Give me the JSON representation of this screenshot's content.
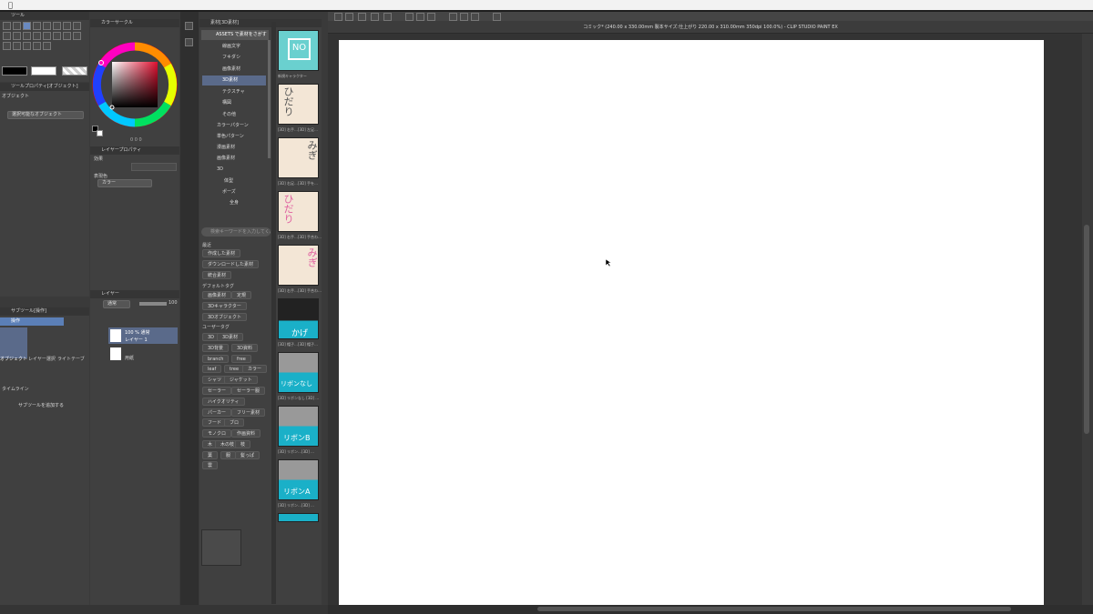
{
  "window_title": "コミック* (240.00 x 330.00mm 製本サイズ:仕上がり 220.00 x 310.00mm 350dpi 100.0%) - CLIP STUDIO PAINT EX",
  "tool_panel": {
    "title": "ツール"
  },
  "color_panel": {
    "title": "カラーサークル",
    "values": "0 0 0"
  },
  "tool_property": {
    "title": "ツールプロパティ[オブジェクト]",
    "subtitle": "オブジェクト",
    "dropdown": "選択可能なオブジェクト"
  },
  "layer_property": {
    "title": "レイヤープロパティ",
    "effect_label": "効果",
    "color_label": "表現色",
    "color_value": "カラー"
  },
  "layer_panel": {
    "title": "レイヤー",
    "blend_mode": "通常",
    "opacity": "100",
    "layers": [
      {
        "line1": "100 % 通常",
        "line2": "レイヤー 1"
      },
      {
        "line1": "",
        "line2": "用紙"
      }
    ]
  },
  "subtool_panel": {
    "title": "サブツール[操作]",
    "group_label": "操作",
    "tools": [
      "オブジェクト",
      "レイヤー選択",
      "ライトテーブ",
      "タイムライン"
    ],
    "add_label": "サブツールを追加する"
  },
  "material_panel": {
    "title": "素材[3D素材]",
    "tree": [
      "ASSETS で素材をさがす",
      "線画文字",
      "フキダシ",
      "画像素材",
      "3D素材",
      "テクスチャ",
      "構図",
      "その他",
      "カラーパターン",
      "単色パターン",
      "漫画素材",
      "画像素材",
      "3D",
      "体型",
      "ポーズ",
      "全身"
    ],
    "search_placeholder": "検索キーワードを入力してくだ...",
    "section_labels": {
      "history": "最近",
      "default": "デフォルトタグ",
      "user": "ユーザータグ"
    },
    "history_tags": [
      "作成した素材",
      "ダウンロードした素材",
      "統合素材"
    ],
    "default_tags": [
      "画像素材",
      "定規",
      "3Dキャラクター",
      "3Dオブジェクト"
    ],
    "user_tags": [
      "3D",
      "3D素材",
      "3D背景",
      "3D資料",
      "branch",
      "free",
      "leaf",
      "tree",
      "カラー",
      "シャツ",
      "ジャケット",
      "セーラー",
      "セーラー服",
      "ハイクオリティ",
      "パーカー",
      "フリー素材",
      "フード",
      "ブロ",
      "モノクロ",
      "作画資料",
      "木",
      "木の枝",
      "枝",
      "葉",
      "服",
      "髪っぱ",
      "雲"
    ]
  },
  "thumbnails": [
    {
      "cap": "新規キャラクター",
      "label": "NO"
    },
    {
      "cap": "[3D] 右手…[3D] 左足…",
      "label": "ひだり"
    },
    {
      "cap": "[3D] 右足…[3D] 手を…",
      "label": "みぎ"
    },
    {
      "cap": "[3D] 右手…[3D] 手合わ…",
      "label": "ひだり"
    },
    {
      "cap": "[3D] 右手…[3D] 手合わ…",
      "label": "みぎ"
    },
    {
      "cap": "[3D] 帽子…[3D] 帽子…",
      "label": "かげ"
    },
    {
      "cap": "[3D] リボンなし [3D] …",
      "label": "リボンなし"
    },
    {
      "cap": "[3D] リボン…[3D] …",
      "label": "リボンB"
    },
    {
      "cap": "[3D] リボン…[3D] …",
      "label": "リボンA"
    }
  ],
  "colors": {
    "bg": "#3a3a3a",
    "panel": "#404040",
    "canvas": "#ffffff",
    "accent": "#5b7fb7",
    "selected_row": "#5a6a8a"
  }
}
